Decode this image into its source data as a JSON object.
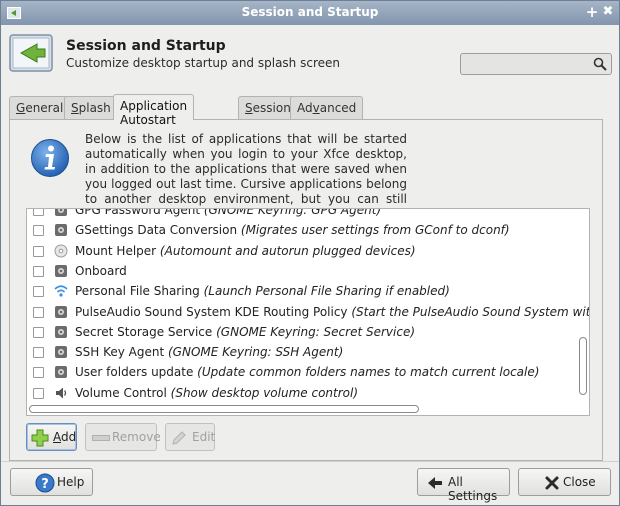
{
  "window": {
    "title": "Session and Startup",
    "pin_glyph": "+",
    "close_glyph": "✖"
  },
  "header": {
    "title": "Session and Startup",
    "subtitle": "Customize desktop startup and splash screen",
    "search": {
      "value": "",
      "placeholder": ""
    }
  },
  "tabs": [
    {
      "label": "General",
      "underline": "G",
      "rest": "eneral",
      "active": false
    },
    {
      "label": "Splash",
      "underline": "S",
      "rest": "plash",
      "active": false
    },
    {
      "label": "Application Autostart",
      "pre": "Application Autostart",
      "active": true
    },
    {
      "label": "Session",
      "underline": "S",
      "rest": "ession",
      "active": false
    },
    {
      "label": "Advanced",
      "pre": "Ad",
      "underline": "v",
      "rest": "anced",
      "active": false
    }
  ],
  "info": {
    "text": "Below is the list of applications that will be started automatically when you login to your Xfce desktop, in addition to the applications that were saved when you logged out last time. Cursive applications belong to another desktop environment, but you can still enable them if you want."
  },
  "autostart": {
    "rows": [
      {
        "name": "GPG Password Agent",
        "desc": " (GNOME Keyring: GPG Agent)",
        "checked": false,
        "icon": "gear-icon"
      },
      {
        "name": "GSettings Data Conversion",
        "desc": " (Migrates user settings from GConf to dconf)",
        "checked": false,
        "icon": "gear-icon"
      },
      {
        "name": "Mount Helper",
        "desc": " (Automount and autorun plugged devices)",
        "checked": false,
        "icon": "disc-icon"
      },
      {
        "name": "Onboard",
        "desc": "",
        "checked": false,
        "icon": "gear-icon"
      },
      {
        "name": "Personal File Sharing",
        "desc": " (Launch Personal File Sharing if enabled)",
        "checked": false,
        "icon": "wifi-icon"
      },
      {
        "name": "PulseAudio Sound System KDE Routing Policy",
        "desc": " (Start the PulseAudio Sound System with KDE Routi",
        "checked": false,
        "icon": "gear-icon"
      },
      {
        "name": "Secret Storage Service",
        "desc": " (GNOME Keyring: Secret Service)",
        "checked": false,
        "icon": "gear-icon"
      },
      {
        "name": "SSH Key Agent",
        "desc": " (GNOME Keyring: SSH Agent)",
        "checked": false,
        "icon": "gear-icon"
      },
      {
        "name": "User folders update",
        "desc": " (Update common folders names to match current locale)",
        "checked": false,
        "icon": "gear-icon"
      },
      {
        "name": "Volume Control",
        "desc": " (Show desktop volume control)",
        "checked": false,
        "icon": "speaker-icon"
      }
    ]
  },
  "actions": {
    "add_u": "A",
    "add_rest": "dd",
    "remove_label": "Remove",
    "edit_label": "Edit"
  },
  "footer": {
    "help_label": "Help",
    "all_settings_label": "All Settings",
    "close_label": "Close"
  },
  "colors": {
    "titlebar": "#8fa1b8",
    "accent": "#3465a4",
    "info_blue": "#2f6fbf"
  }
}
